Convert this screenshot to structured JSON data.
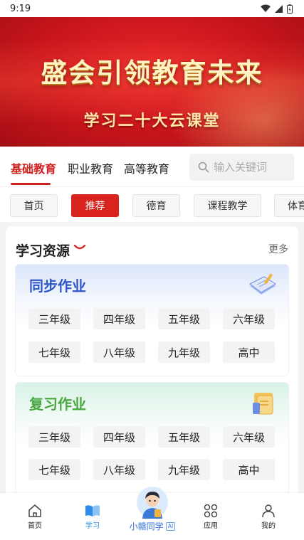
{
  "status_bar": {
    "time": "9:19"
  },
  "banner": {
    "title": "盛会引领教育未来",
    "subtitle": "学习二十大云课堂"
  },
  "edu_tabs": [
    "基础教育",
    "职业教育",
    "高等教育"
  ],
  "search": {
    "placeholder": "输入关键词"
  },
  "categories": [
    "首页",
    "推荐",
    "德育",
    "课程教学",
    "体育"
  ],
  "resources": {
    "title": "学习资源",
    "more": "更多",
    "sections": [
      {
        "title": "同步作业",
        "grades": [
          "三年级",
          "四年级",
          "五年级",
          "六年级",
          "七年级",
          "八年级",
          "九年级",
          "高中"
        ]
      },
      {
        "title": "复习作业",
        "grades": [
          "三年级",
          "四年级",
          "五年级",
          "六年级",
          "七年级",
          "八年级",
          "九年级",
          "高中"
        ]
      }
    ]
  },
  "bottom_nav": {
    "home": "首页",
    "study": "学习",
    "assistant": "小赣同学",
    "assistant_tag": "AI",
    "apps": "应用",
    "mine": "我的"
  },
  "colors": {
    "accent_red": "#d8241d",
    "active_blue": "#2f8be6",
    "sync_blue": "#2f56c9",
    "review_green": "#49a640"
  }
}
